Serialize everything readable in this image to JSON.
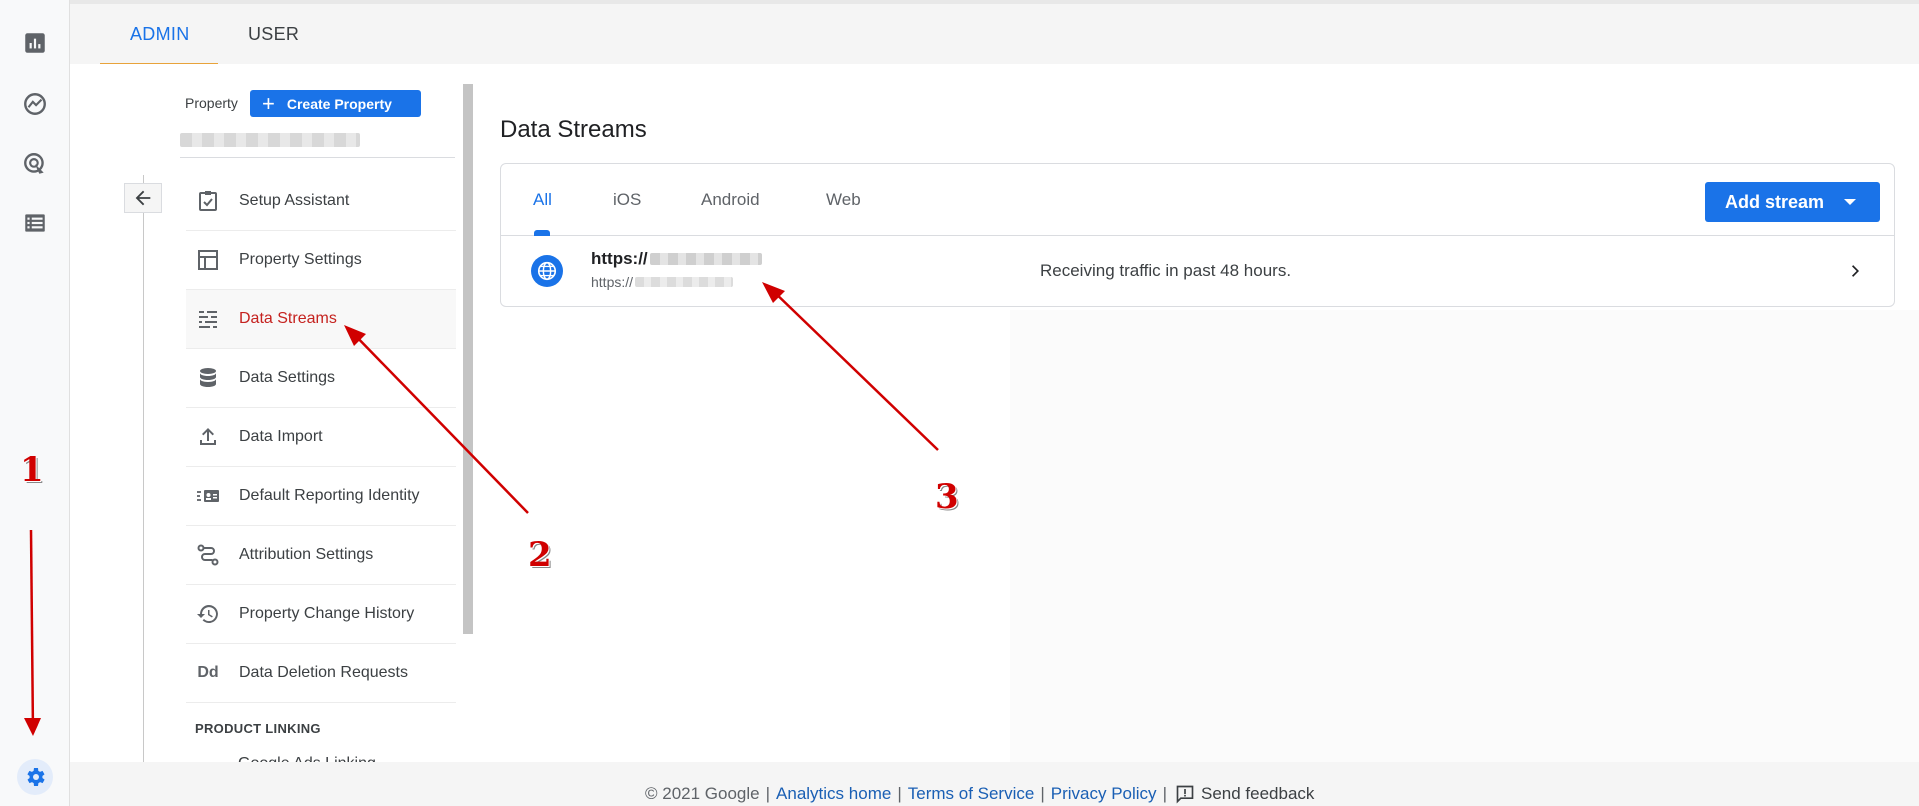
{
  "top_tabs": {
    "admin": "ADMIN",
    "user": "USER"
  },
  "property": {
    "label": "Property",
    "create_button": "Create Property",
    "create_icon": "+"
  },
  "menu": [
    {
      "label": "Setup Assistant",
      "icon": "checklist-icon"
    },
    {
      "label": "Property Settings",
      "icon": "layout-icon"
    },
    {
      "label": "Data Streams",
      "icon": "streams-icon",
      "active": true
    },
    {
      "label": "Data Settings",
      "icon": "database-icon"
    },
    {
      "label": "Data Import",
      "icon": "upload-icon"
    },
    {
      "label": "Default Reporting Identity",
      "icon": "identity-icon"
    },
    {
      "label": "Attribution Settings",
      "icon": "attribution-icon"
    },
    {
      "label": "Property Change History",
      "icon": "history-icon"
    },
    {
      "label": "Data Deletion Requests",
      "icon": "deletion-icon"
    }
  ],
  "product_linking": {
    "heading": "PRODUCT LINKING",
    "first_item": "Google Ads Linking"
  },
  "data_streams": {
    "title": "Data Streams",
    "tabs": [
      "All",
      "iOS",
      "Android",
      "Web"
    ],
    "active_tab": "All",
    "add_button": "Add stream",
    "stream": {
      "name_prefix": "https://",
      "url_prefix": "https://",
      "status": "Receiving traffic in past 48 hours."
    }
  },
  "footer": {
    "copyright": "© 2021 Google",
    "analytics_home": "Analytics home",
    "terms": "Terms of Service",
    "privacy": "Privacy Policy",
    "feedback": "Send feedback",
    "sep": "|"
  },
  "annotations": {
    "n1": "1",
    "n2": "2",
    "n3": "3"
  },
  "colors": {
    "accent": "#1a73e8",
    "active_text": "#c5221f",
    "annotation": "#d00000",
    "tab_underline": "#e8a33a"
  }
}
